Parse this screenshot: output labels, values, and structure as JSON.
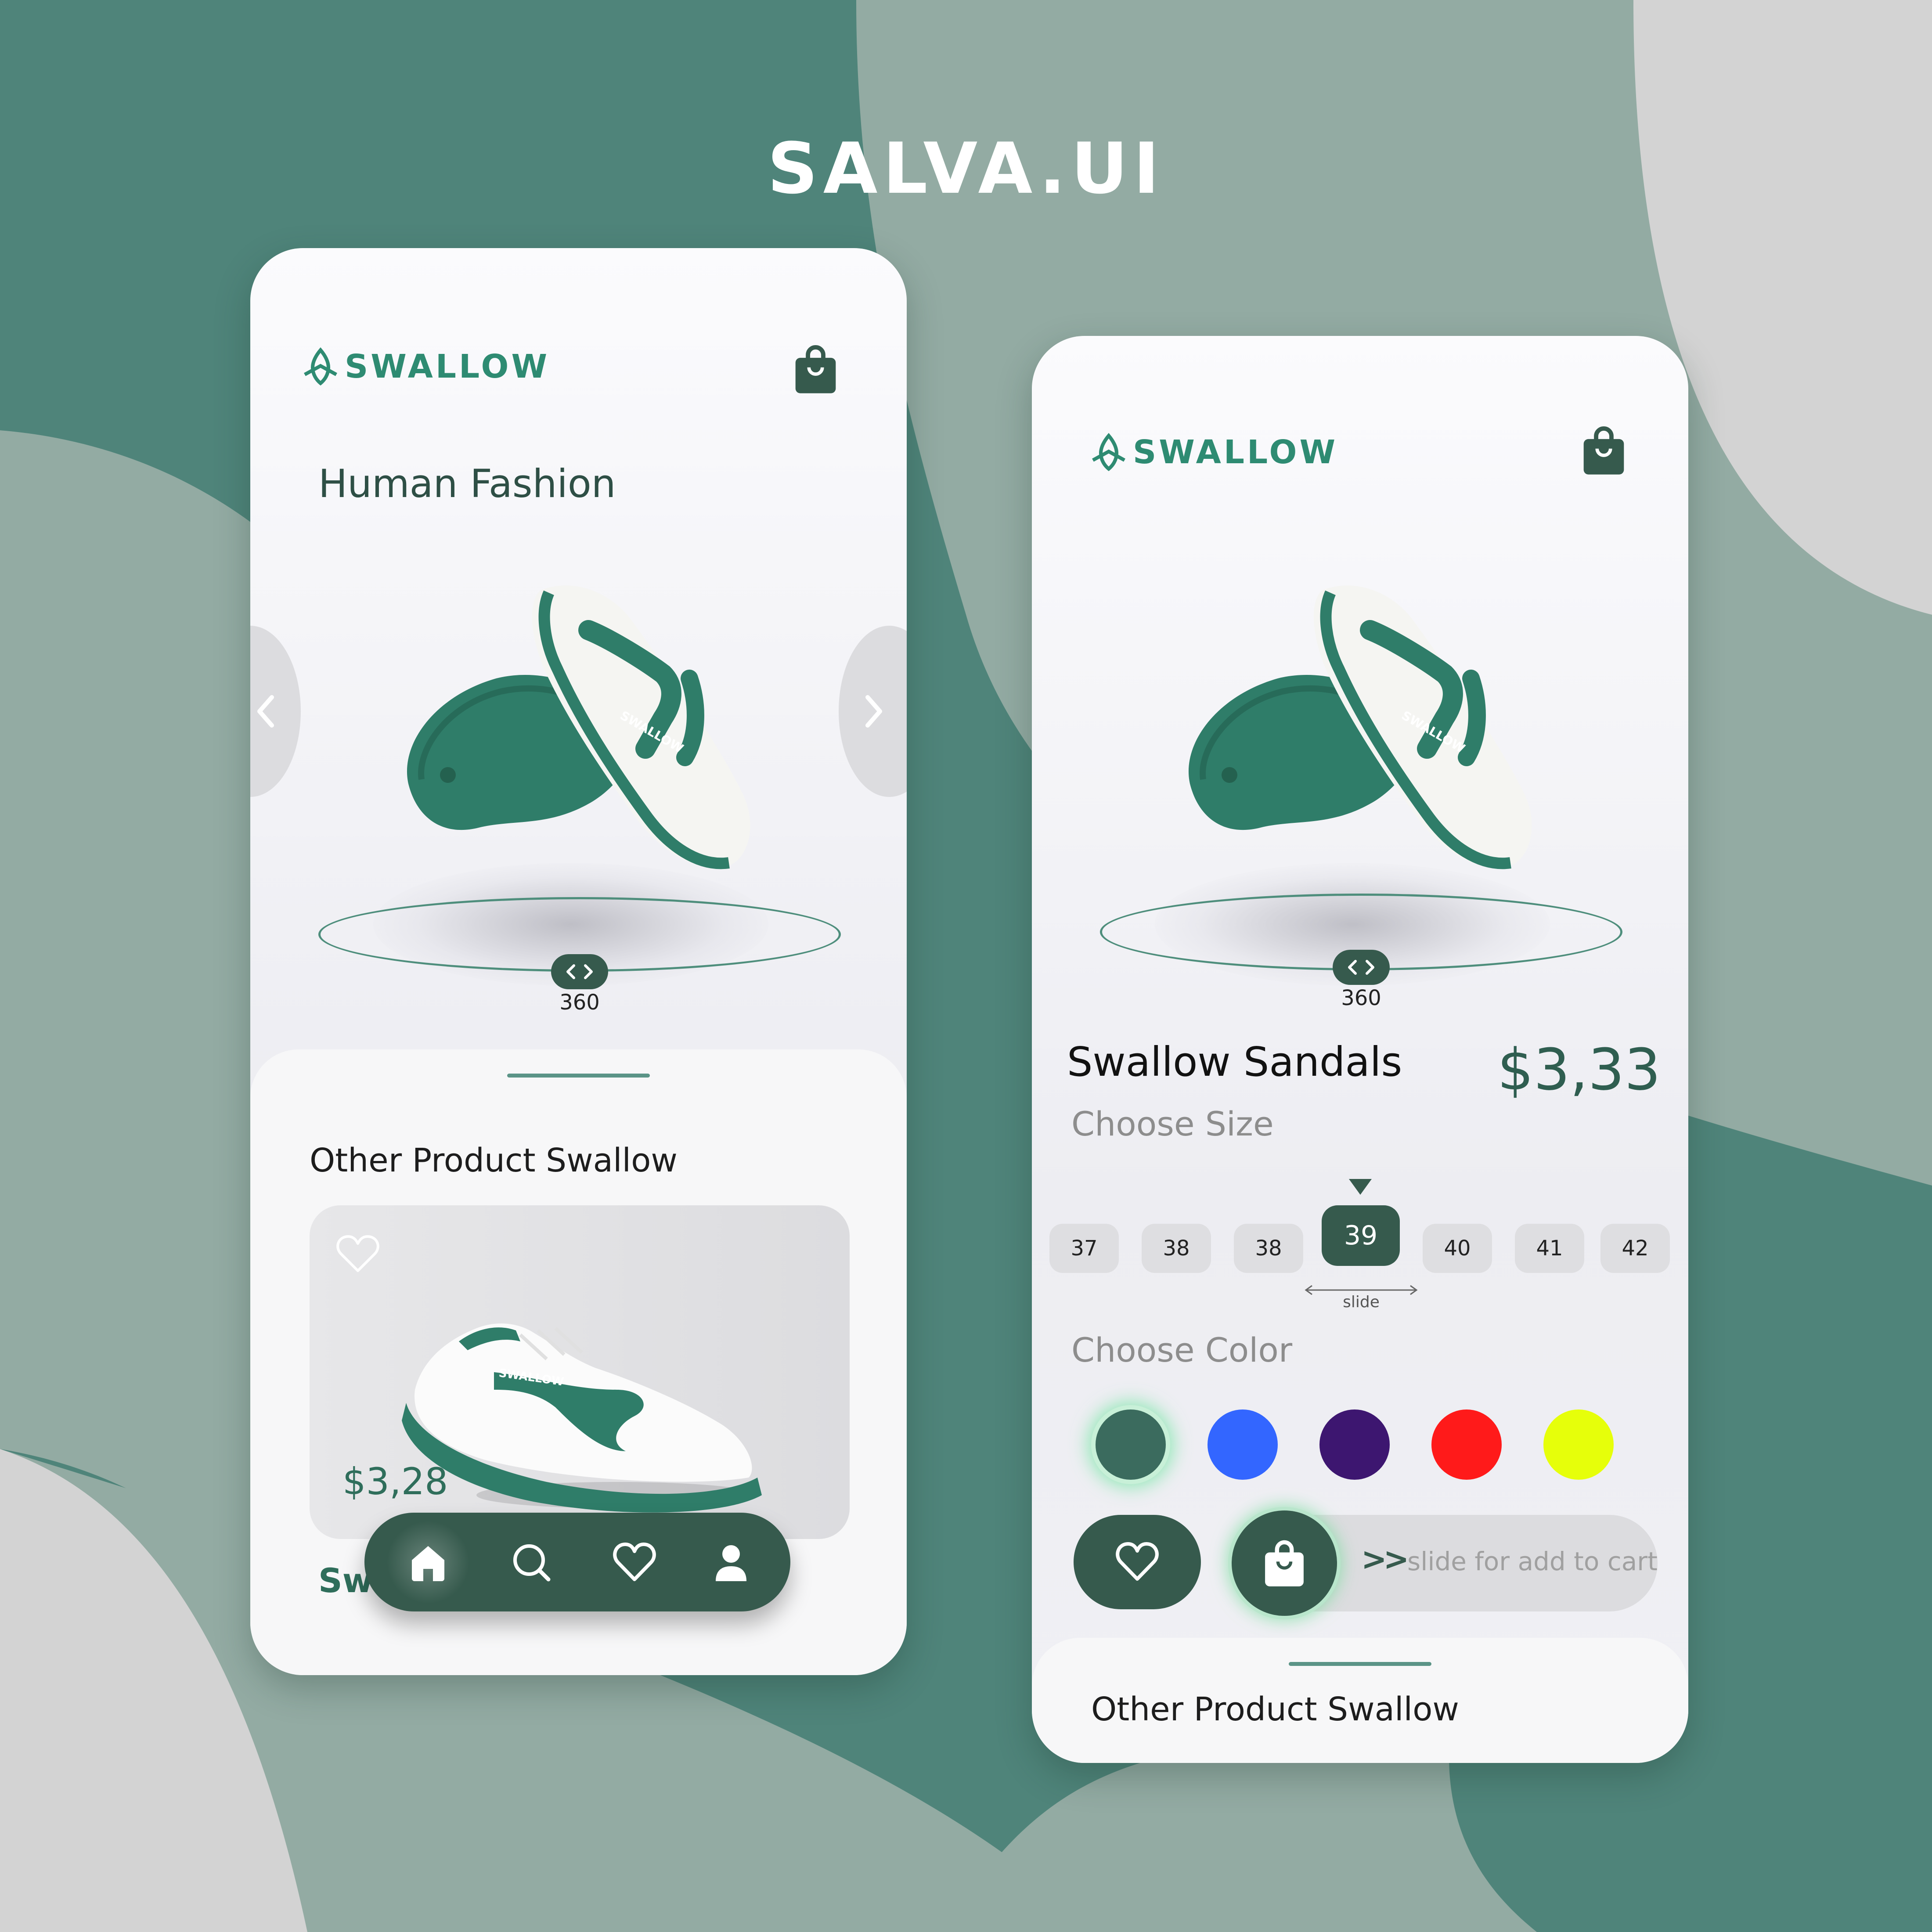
{
  "brand": "SALVA.UI",
  "colors": {
    "primary": "#365a4d",
    "accent": "#2e8b72",
    "bg_dark": "#4f847a",
    "bg_mid": "#93aba3",
    "bg_light": "#d3d3d3"
  },
  "left_screen": {
    "logo_text": "SWALLOW",
    "heading": "Human Fashion",
    "rotate_label": "360",
    "other_section_title": "Other Product Swallow",
    "card": {
      "price": "$3,28",
      "name": "Swa"
    },
    "tabbar": {
      "items": [
        "home-icon",
        "search-icon",
        "heart-icon",
        "user-icon"
      ],
      "active": "home-icon"
    }
  },
  "right_screen": {
    "logo_text": "SWALLOW",
    "rotate_label": "360",
    "product_name": "Swallow Sandals",
    "product_price": "$3,33",
    "choose_size_label": "Choose Size",
    "sizes": [
      "37",
      "38",
      "38",
      "39",
      "40",
      "41",
      "42"
    ],
    "selected_size": "39",
    "slide_hint": "slide",
    "choose_color_label": "Choose Color",
    "colors": [
      "#3b6b5e",
      "#3366ff",
      "#3d1670",
      "#ff1a1a",
      "#e6ff0a"
    ],
    "selected_color": "#3b6b5e",
    "cart_slider_chevrons": ">>",
    "cart_slider_text": "slide for add to cart",
    "other_section_title": "Other Product Swallow"
  }
}
